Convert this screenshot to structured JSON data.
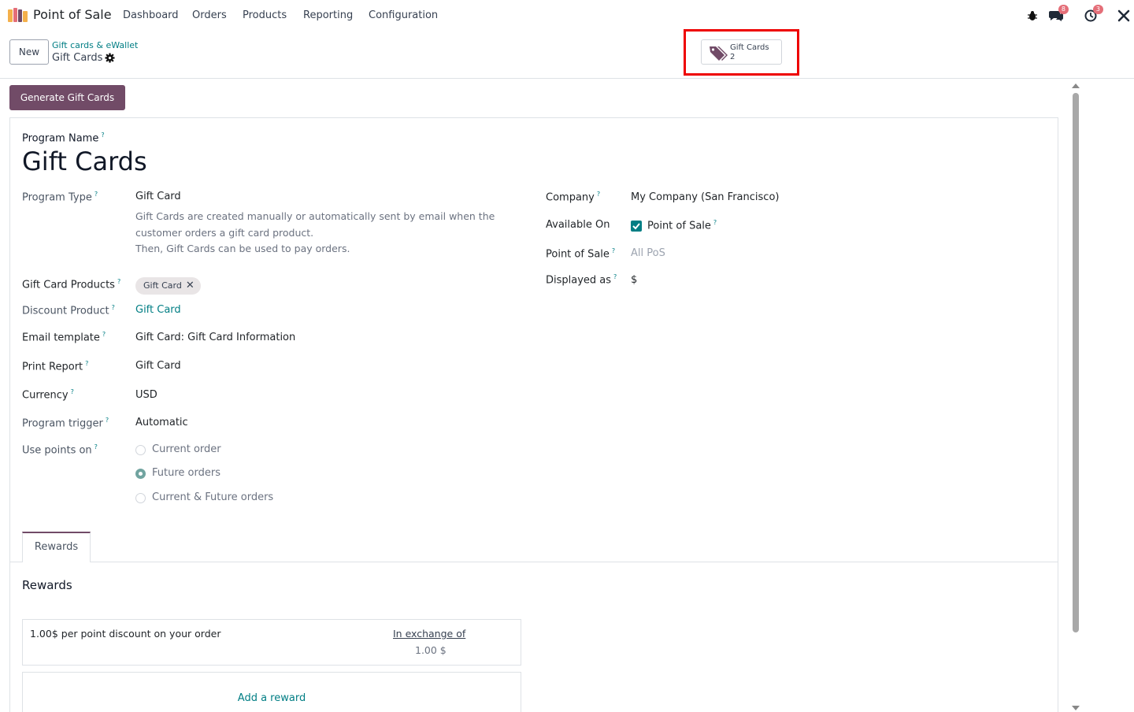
{
  "app": {
    "name": "Point of Sale",
    "menu": [
      "Dashboard",
      "Orders",
      "Products",
      "Reporting",
      "Configuration"
    ]
  },
  "systray": {
    "messages_badge": "8",
    "activities_badge": "3"
  },
  "control_panel": {
    "new_label": "New",
    "breadcrumb_parent": "Gift cards & eWallet",
    "breadcrumb_current": "Gift Cards",
    "stat_label": "Gift Cards",
    "stat_value": "2"
  },
  "actions": {
    "generate_label": "Generate Gift Cards"
  },
  "form": {
    "program_name_label": "Program Name",
    "program_name": "Gift Cards",
    "program_type_label": "Program Type",
    "program_type": "Gift Card",
    "program_type_desc_1": "Gift Cards are created manually or automatically sent by email when the",
    "program_type_desc_2": "customer orders a gift card product.",
    "program_type_desc_3": "Then, Gift Cards can be used to pay orders.",
    "gift_card_products_label": "Gift Card Products",
    "gift_card_products_tag": "Gift Card",
    "discount_product_label": "Discount Product",
    "discount_product": "Gift Card",
    "email_template_label": "Email template",
    "email_template": "Gift Card: Gift Card Information",
    "print_report_label": "Print Report",
    "print_report": "Gift Card",
    "currency_label": "Currency",
    "currency": "USD",
    "program_trigger_label": "Program trigger",
    "program_trigger": "Automatic",
    "use_points_label": "Use points on",
    "use_points_options": [
      "Current order",
      "Future orders",
      "Current & Future orders"
    ],
    "use_points_selected": "Future orders",
    "company_label": "Company",
    "company": "My Company (San Francisco)",
    "available_on_label": "Available On",
    "available_on_option": "Point of Sale",
    "available_on_checked": true,
    "pos_label": "Point of Sale",
    "pos_placeholder": "All PoS",
    "displayed_as_label": "Displayed as",
    "displayed_as": "$"
  },
  "tabs": [
    "Rewards"
  ],
  "rewards": {
    "section_title": "Rewards",
    "items": [
      {
        "description": "1.00$ per point discount on your order",
        "exchange_label": "In exchange of",
        "points": "1.00 $"
      }
    ],
    "add_label": "Add a reward"
  },
  "colors": {
    "brand": "#714b67",
    "link": "#017e84",
    "highlight": "#ee0000",
    "badge": "#e46e78"
  },
  "icons": {
    "logo": "pos-app-icon",
    "debug": "bug-icon",
    "messages": "chat-icon",
    "activities": "clock-icon",
    "tools": "tools-icon",
    "settings": "gear-icon",
    "stat": "tags-icon"
  }
}
